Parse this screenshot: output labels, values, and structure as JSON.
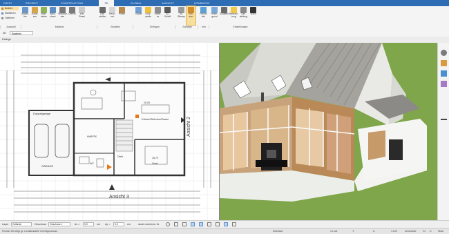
{
  "tabs": [
    "DATEI",
    "PROJEKT",
    "KONSTRUKTION",
    "3D",
    "GLOBAL",
    "ANSICHT",
    "KOMBATOR"
  ],
  "ribbon": {
    "left_buttons": [
      "Ändern",
      "Markieren",
      "Optionen"
    ],
    "buttons": [
      {
        "label": "Abgrei-\nfen",
        "group": "Auswahl"
      },
      {
        "label": "Zuwei-\nsen",
        "group": "Material"
      },
      {
        "label": "Bear-\nbeiten",
        "group": "Material"
      },
      {
        "label": "Bako-\nnisen",
        "group": "Material"
      },
      {
        "label": "Verschie-\nben",
        "group": "Material"
      },
      {
        "label": "Drehen",
        "group": "Material"
      },
      {
        "label": "Wie\nPinsel",
        "group": "Material"
      },
      {
        "label": "Dar-\nstellen",
        "group": "Schatten"
      },
      {
        "label": "Rech-\nnet",
        "group": "Schatten"
      },
      {
        "label": "Pinsel",
        "group": "Schatten"
      },
      {
        "label": "Objekt",
        "group": "Einfügen"
      },
      {
        "label": "Licht-\nquelle",
        "group": "Einfügen"
      },
      {
        "label": "Kame-\nra",
        "group": "Einfügen"
      },
      {
        "label": "3D-\nSchrift",
        "group": "Einfügen"
      },
      {
        "label": "3D-\nBitmap",
        "group": "Sonstige"
      },
      {
        "label": "Kufi-\nsion",
        "group": "Sonstige"
      },
      {
        "label": "Fläche\ninfo",
        "group": "Info"
      },
      {
        "label": "Hinter-\ngrund",
        "group": "Einstellungen"
      },
      {
        "label": "Schatten",
        "group": "Einstellungen"
      },
      {
        "label": "Beleuch-\ntung",
        "group": "Einstellungen"
      },
      {
        "label": "Dar-\nstellung",
        "group": "Einstellungen"
      },
      {
        "label": "Video",
        "group": "Einstellungen"
      }
    ],
    "groups": [
      "Auswahl",
      "Material",
      "Schatten",
      "Einfügen",
      "Sonstige",
      "Info",
      "Einstellungen"
    ]
  },
  "toolbar": {
    "view_select": "Ergebnis",
    "floor_label": "3D",
    "dialog_tab": "Dialoge"
  },
  "plan": {
    "rooms": [
      "Doppelgarage",
      "GARAGE",
      "Küche/Wohnen/Essen",
      "HWR/TK",
      "Diele",
      "Gast",
      "WC"
    ],
    "labels": [
      "Ansicht 2",
      "Ansicht 3"
    ],
    "areas": [
      "20,03",
      "15,70"
    ]
  },
  "bottom": {
    "layer_label": "Layer",
    "layer_value": "Gelände",
    "geschoss_label": "Geschoss",
    "geschoss_value": "Geschoss 1",
    "dx_label": "dx =",
    "dx_value": "0,0",
    "dx_unit": "cm",
    "dy_label": "dy =",
    "dy_value": "0,0",
    "dy_unit": "cm",
    "hint": "doubl zeichnen fix"
  },
  "status": {
    "left": "Fenster für Mögl. gr. Lichtstrautiefe Gr.Erdgeschoss",
    "mode": "Selektion",
    "x": "1:1 sel",
    "y": "Y:",
    "z": "Z:",
    "scale": "1:100",
    "unit": "Zentimeter",
    "caps": "Gr",
    "num": "NUM",
    "zoom": "U"
  },
  "colors": {
    "tabbar": "#2e6db4",
    "grass": "#7fa64a",
    "selected": "#f8dfa0"
  }
}
